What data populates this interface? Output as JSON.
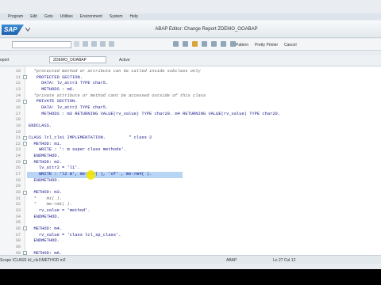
{
  "menu": [
    "Program",
    "Edit",
    "Goto",
    "Utilities",
    "Environment",
    "System",
    "Help"
  ],
  "title": "ABAP Editor: Change Report ZDEMO_OOABAP",
  "logo_text": "SAP",
  "toolbar": {
    "pattern": "Pattern",
    "pretty_printer": "Pretty Printer",
    "cancel": "Cancel"
  },
  "toolbar2": {
    "report_label": "eport",
    "program": "ZDEMO_OOABAP",
    "status": "Active"
  },
  "editor": {
    "lines": [
      {
        "n": "10",
        "text": "  *protected method or attribute can be called inside subclass only",
        "kind": "c"
      },
      {
        "n": "11",
        "text": "   PROTECTED SECTION.",
        "kind": "k"
      },
      {
        "n": "12",
        "text": "     DATA: lv_attr3 TYPE char5.",
        "kind": "k"
      },
      {
        "n": "13",
        "text": "     METHODS : m6.",
        "kind": "k"
      },
      {
        "n": "14",
        "text": "  *private attribute or method cant be accessed outside of this class",
        "kind": "c"
      },
      {
        "n": "15",
        "text": "   PRIVATE SECTION.",
        "kind": "k"
      },
      {
        "n": "16",
        "text": "     DATA: lv_attr2 TYPE char5.",
        "kind": "k"
      },
      {
        "n": "17",
        "text": "     METHODS : m3 RETURNING VALUE(rv_value) TYPE char20. m4 RETURNING VALUE(rv_value) TYPE char20.",
        "kind": "k"
      },
      {
        "n": "18",
        "text": "",
        "kind": "k"
      },
      {
        "n": "19",
        "text": "ENDCLASS.",
        "kind": "k"
      },
      {
        "n": "20",
        "text": "",
        "kind": "k"
      },
      {
        "n": "21",
        "text": "CLASS lcl_cls1 IMPLEMENTATION.         \" class 2",
        "kind": "k"
      },
      {
        "n": "22",
        "text": "  METHOD: m1.",
        "kind": "k"
      },
      {
        "n": "23",
        "text": "    WRITE : ': m super class methods'.",
        "kind": "k"
      },
      {
        "n": "24",
        "text": "  ENDMETHOD.",
        "kind": "k"
      },
      {
        "n": "25",
        "text": "  METHOD: m2.",
        "kind": "k"
      },
      {
        "n": "26",
        "text": "    lv_attr2 = 'l1'.",
        "kind": "k"
      },
      {
        "n": "27",
        "text": "    WRITE : 'l2 m', me->m3( ), 'of' , me->m4( ).",
        "kind": "k"
      },
      {
        "n": "28",
        "text": "  ENDMETHOD.",
        "kind": "k"
      },
      {
        "n": "29",
        "text": "",
        "kind": "k"
      },
      {
        "n": "30",
        "text": "  METHOD: m3.",
        "kind": "k"
      },
      {
        "n": "31",
        "text": "  *    m1( ).",
        "kind": "c"
      },
      {
        "n": "32",
        "text": "  *    me->m1( ).",
        "kind": "c"
      },
      {
        "n": "33",
        "text": "    rv_value = 'method'.",
        "kind": "k"
      },
      {
        "n": "34",
        "text": "  ENDMETHOD.",
        "kind": "k"
      },
      {
        "n": "35",
        "text": "",
        "kind": "k"
      },
      {
        "n": "36",
        "text": "  METHOD: m4.",
        "kind": "k"
      },
      {
        "n": "37",
        "text": "    rv_value = 'class lcl_sp_class'.",
        "kind": "k"
      },
      {
        "n": "38",
        "text": "  ENDMETHOD.",
        "kind": "k"
      },
      {
        "n": "39",
        "text": "",
        "kind": "k"
      },
      {
        "n": "40",
        "text": "  METHOD: m6.",
        "kind": "k"
      }
    ]
  },
  "status": {
    "scope": "Scope \\CLASS lcl_cls1\\METHOD m2",
    "language": "ABAP",
    "position": "Ln  27 Col  12"
  }
}
